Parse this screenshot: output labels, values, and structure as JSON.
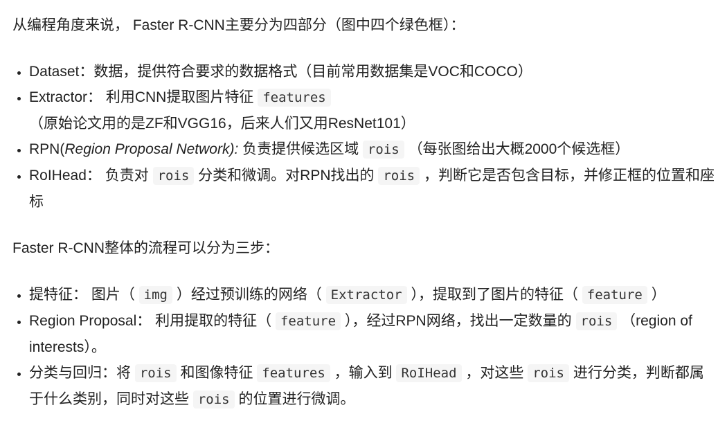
{
  "blocks": [
    {
      "type": "p",
      "segments": [
        {
          "t": "从编程角度来说， Faster R-CNN主要分为四部分（图中四个绿色框）："
        }
      ]
    },
    {
      "type": "ul",
      "items": [
        [
          {
            "t": "Dataset：数据，提供符合要求的数据格式（目前常用数据集是VOC和COCO）"
          }
        ],
        [
          {
            "t": "Extractor： 利用CNN提取图片特征 "
          },
          {
            "t": "features",
            "code": true
          },
          {
            "t": " （原始论文用的是ZF和VGG16，后来人们又用ResNet101）"
          }
        ],
        [
          {
            "t": "RPN("
          },
          {
            "t": "Region Proposal Network):",
            "em": true
          },
          {
            "t": " 负责提供候选区域 "
          },
          {
            "t": "rois",
            "code": true
          },
          {
            "t": " （每张图给出大概2000个候选框）"
          }
        ],
        [
          {
            "t": "RoIHead： 负责对 "
          },
          {
            "t": "rois",
            "code": true
          },
          {
            "t": " 分类和微调。对RPN找出的 "
          },
          {
            "t": "rois",
            "code": true
          },
          {
            "t": " ，判断它是否包含目标，并修正框的位置和座标"
          }
        ]
      ]
    },
    {
      "type": "p",
      "segments": [
        {
          "t": "Faster R-CNN整体的流程可以分为三步："
        }
      ]
    },
    {
      "type": "ul",
      "items": [
        [
          {
            "t": "提特征： 图片（ "
          },
          {
            "t": "img",
            "code": true
          },
          {
            "t": " ）经过预训练的网络（ "
          },
          {
            "t": "Extractor",
            "code": true
          },
          {
            "t": " ），提取到了图片的特征（ "
          },
          {
            "t": "feature",
            "code": true
          },
          {
            "t": " ）"
          }
        ],
        [
          {
            "t": "Region Proposal： 利用提取的特征（ "
          },
          {
            "t": "feature",
            "code": true
          },
          {
            "t": " ），经过RPN网络，找出一定数量的 "
          },
          {
            "t": "rois",
            "code": true
          },
          {
            "t": " （region of interests）。"
          }
        ],
        [
          {
            "t": "分类与回归：将 "
          },
          {
            "t": "rois",
            "code": true
          },
          {
            "t": " 和图像特征 "
          },
          {
            "t": "features",
            "code": true
          },
          {
            "t": " ，输入到 "
          },
          {
            "t": "RoIHead",
            "code": true
          },
          {
            "t": " ，对这些 "
          },
          {
            "t": "rois",
            "code": true
          },
          {
            "t": " 进行分类，判断都属于什么类别，同时对这些 "
          },
          {
            "t": "rois",
            "code": true
          },
          {
            "t": " 的位置进行微调。"
          }
        ]
      ]
    }
  ]
}
